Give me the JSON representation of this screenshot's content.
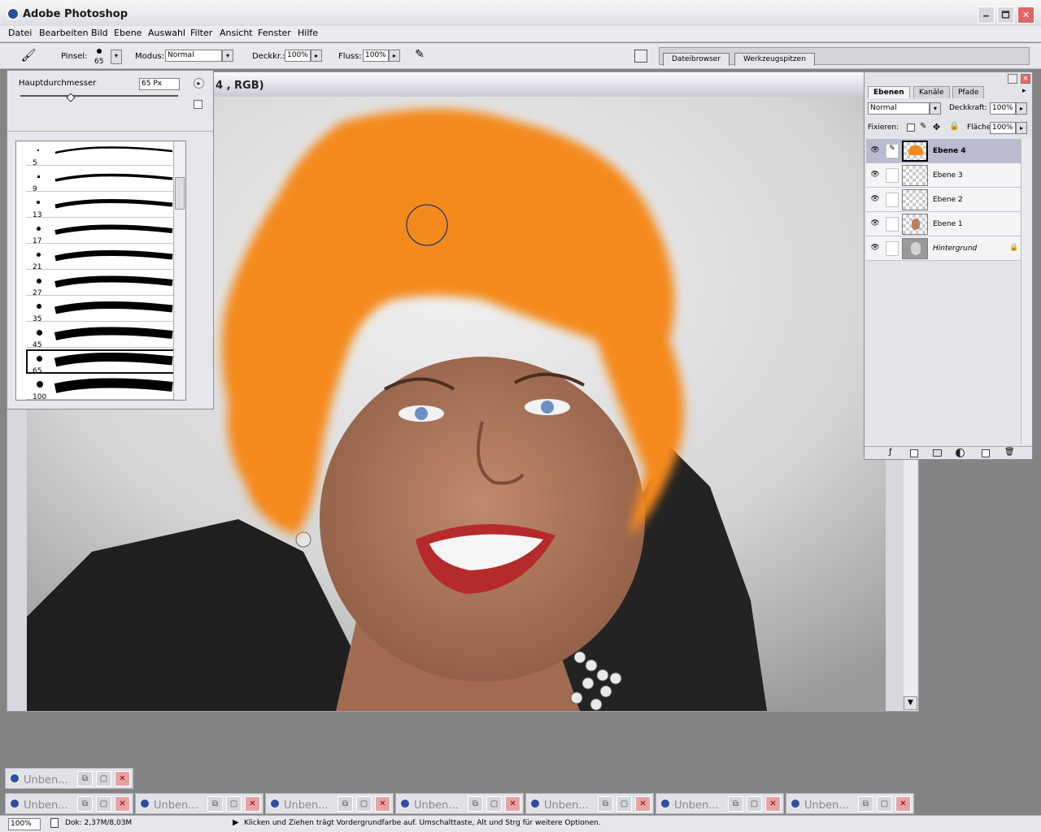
{
  "app": {
    "title": "Adobe Photoshop"
  },
  "window_controls": {
    "minimize": "🗕",
    "maximize": "🗖",
    "close": "✕"
  },
  "menu": [
    "Datei",
    "Bearbeiten",
    "Bild",
    "Ebene",
    "Auswahl",
    "Filter",
    "Ansicht",
    "Fenster",
    "Hilfe"
  ],
  "options": {
    "brush_label": "Pinsel:",
    "brush_size": "65",
    "mode_label": "Modus:",
    "mode_value": "Normal",
    "opacity_label": "Deckkr.:",
    "opacity_value": "100%",
    "flow_label": "Fluss:",
    "flow_value": "100%",
    "tab_file_browser": "Dateibrowser",
    "tab_brushes": "Werkzeugspitzen"
  },
  "document": {
    "title": "4 , RGB)"
  },
  "brush_picker": {
    "diameter_label": "Hauptdurchmesser",
    "diameter_value": "65 Px",
    "sizes": [
      "5",
      "9",
      "13",
      "17",
      "21",
      "27",
      "35",
      "45",
      "65",
      "100"
    ],
    "selected": "65"
  },
  "layers": {
    "tabs": [
      "Ebenen",
      "Kanäle",
      "Pfade"
    ],
    "blend_mode": "Normal",
    "opacity_label": "Deckkraft:",
    "opacity_value": "100%",
    "lock_label": "Fixieren:",
    "fill_label": "Fläche",
    "fill_value": "100%",
    "items": [
      {
        "name": "Ebene 4",
        "active": true
      },
      {
        "name": "Ebene 3",
        "active": false
      },
      {
        "name": "Ebene 2",
        "active": false
      },
      {
        "name": "Ebene 1",
        "active": false
      },
      {
        "name": "Hintergrund",
        "active": false
      }
    ]
  },
  "minimized_windows": [
    "Unben...",
    "Unben...",
    "Unben...",
    "Unben...",
    "Unben...",
    "Unben...",
    "Unben...",
    "Unben...",
    "Unben..."
  ],
  "status": {
    "zoom": "100%",
    "doc_info": "Dok: 2,37M/8,03M",
    "hint": "Klicken und Ziehen trägt Vordergrundfarbe auf. Umschalttaste, Alt und Strg für weitere Optionen."
  },
  "colors": {
    "paint": "#f58a1e",
    "accent": "#2d4ea1"
  }
}
